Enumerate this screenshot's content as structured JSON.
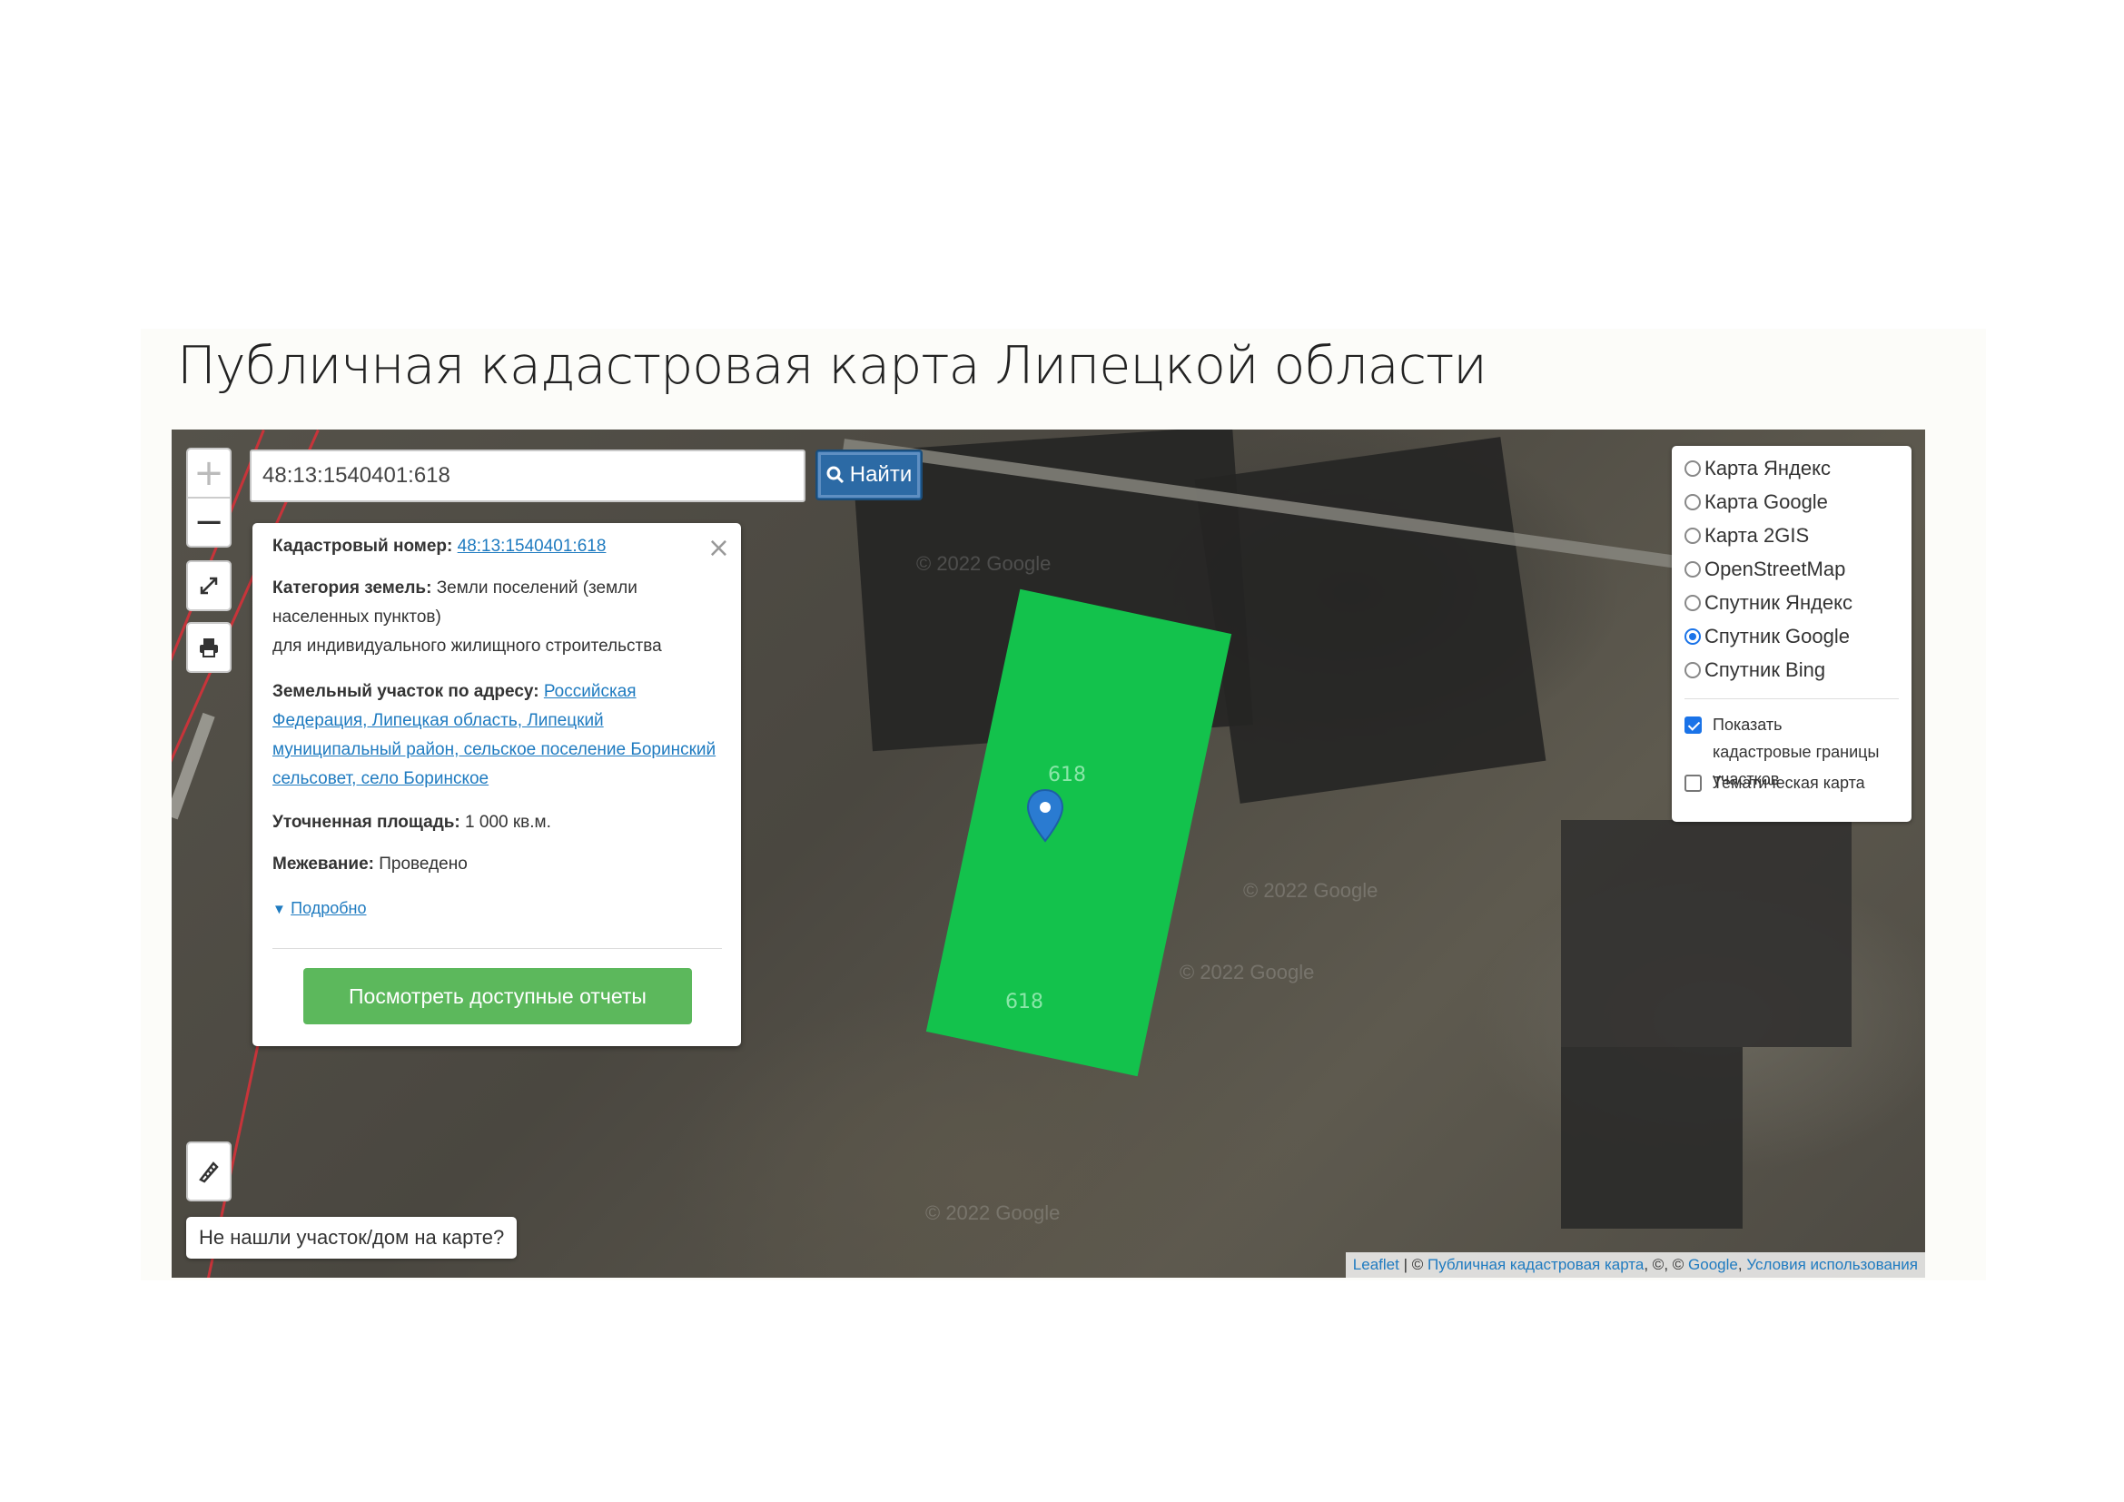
{
  "page": {
    "title": "Публичная кадастровая карта Липецкой области"
  },
  "search": {
    "value": "48:13:1540401:618",
    "button_label": "Найти"
  },
  "zoom": {
    "in": "+",
    "out": "−"
  },
  "popup": {
    "cadastral_label": "Кадастровый номер:",
    "cadastral_value": "48:13:1540401:618",
    "category_label": "Категория земель:",
    "category_value": "Земли поселений (земли населенных пунктов)",
    "category_usage": "для индивидуального жилищного строительства",
    "address_label": "Земельный участок по адресу:",
    "address_value": "Российская Федерация, Липецкая область, Липецкий муниципальный район, сельское поселение Боринский сельсовет, село Боринское",
    "area_label": "Уточненная площадь:",
    "area_value": "1 000 кв.м.",
    "survey_label": "Межевание:",
    "survey_value": "Проведено",
    "details_link": "Подробно",
    "report_button": "Посмотреть доступные отчеты",
    "close": "×"
  },
  "parcel": {
    "label_top": "618",
    "label_bottom": "618"
  },
  "layers": {
    "options": [
      {
        "label": "Карта Яндекс",
        "selected": false
      },
      {
        "label": "Карта Google",
        "selected": false
      },
      {
        "label": "Карта 2GIS",
        "selected": false
      },
      {
        "label": "OpenStreetMap",
        "selected": false
      },
      {
        "label": "Спутник Яндекс",
        "selected": false
      },
      {
        "label": "Спутник Google",
        "selected": true
      },
      {
        "label": "Спутник Bing",
        "selected": false
      }
    ],
    "overlays": [
      {
        "label": "Показать кадастровые границы участков",
        "checked": true
      },
      {
        "label": "Тематическая карта",
        "checked": false
      }
    ]
  },
  "notfound_label": "Не нашли участок/дом на карте?",
  "attribution": {
    "leaflet": "Leaflet",
    "sep1": " | © ",
    "pkk": "Публичная кадастровая карта",
    "sep2": ", ©, © ",
    "google": "Google",
    "sep3": ", ",
    "terms": "Условия использования"
  },
  "watermark": "© 2022 Google",
  "colors": {
    "parcel": "#13c24c",
    "accent": "#2c6aa5",
    "report_button": "#5cb85c",
    "link": "#1f7bc0"
  }
}
